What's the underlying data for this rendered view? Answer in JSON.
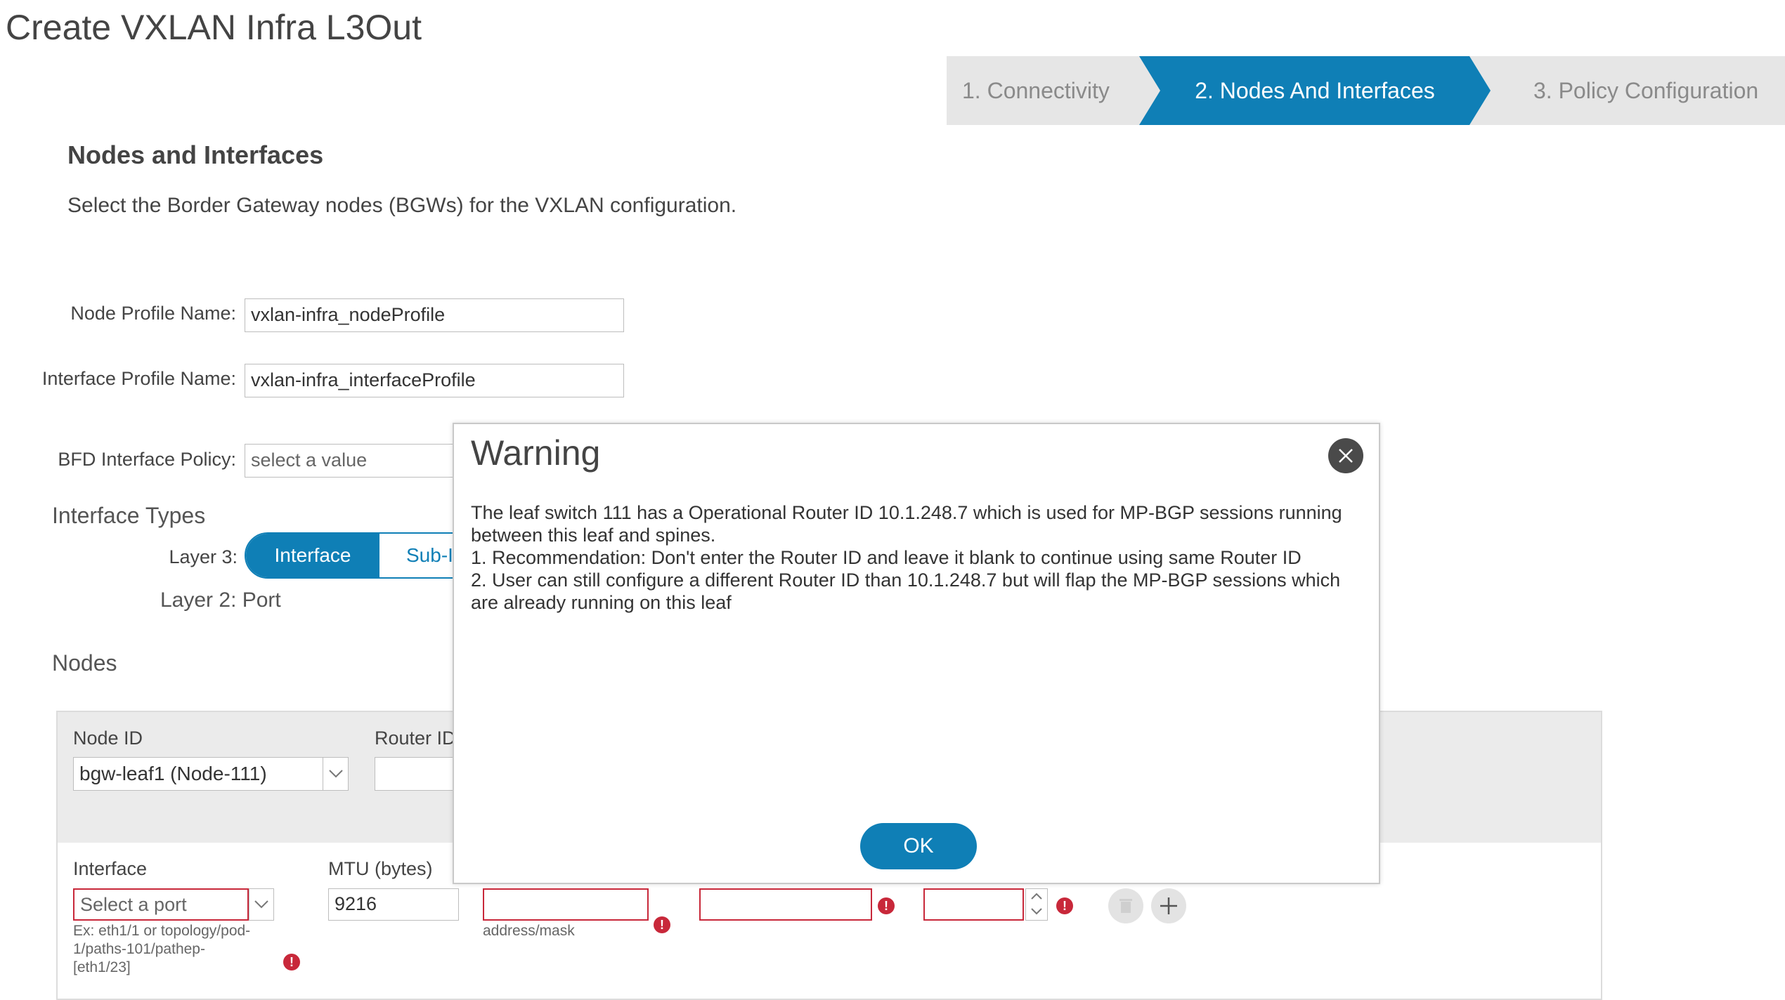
{
  "page": {
    "title": "Create VXLAN Infra L3Out"
  },
  "wizard": {
    "steps": [
      {
        "label": "1. Connectivity"
      },
      {
        "label": "2. Nodes And Interfaces"
      },
      {
        "label": "3. Policy Configuration"
      }
    ],
    "active_step": 2
  },
  "section": {
    "heading": "Nodes and Interfaces",
    "description": "Select the Border Gateway nodes (BGWs) for the VXLAN configuration."
  },
  "form": {
    "node_profile": {
      "label": "Node Profile Name:",
      "value": "vxlan-infra_nodeProfile"
    },
    "interface_profile": {
      "label": "Interface Profile Name:",
      "value": "vxlan-infra_interfaceProfile"
    },
    "bfd_policy": {
      "label": "BFD Interface Policy:",
      "placeholder": "select a value"
    }
  },
  "interface_types": {
    "heading": "Interface Types",
    "layer3_label": "Layer 3:",
    "options": [
      "Interface",
      "Sub-I"
    ],
    "selected": "Interface",
    "layer2_label": "Layer 2: Port"
  },
  "nodes": {
    "heading": "Nodes",
    "node_id_label": "Node ID",
    "node_id_value": "bgw-leaf1 (Node-111)",
    "router_id_label": "Router ID",
    "interface_label": "Interface",
    "interface_placeholder": "Select a port",
    "interface_hint": [
      "Ex: eth1/1 or topology/pod-",
      "1/paths-101/pathep-",
      "[eth1/23]"
    ],
    "mtu_label": "MTU (bytes)",
    "mtu_value": "9216",
    "address_hint": "address/mask"
  },
  "modal": {
    "title": "Warning",
    "lines": [
      "The leaf switch 111 has a Operational Router ID 10.1.248.7 which is used for MP-BGP sessions running",
      "between this leaf and spines.",
      "1. Recommendation: Don't enter the Router ID and leave it blank to continue using same Router ID",
      "2. User can still configure a different Router ID than 10.1.248.7 but will flap the MP-BGP sessions which",
      "are already running on this leaf"
    ],
    "ok_label": "OK"
  },
  "colors": {
    "accent": "#0f7fb6",
    "error": "#c8283a"
  },
  "icons": [
    "close-icon",
    "chevron-down-icon",
    "error-icon",
    "stepper-up-icon",
    "stepper-down-icon",
    "delete-icon",
    "add-icon"
  ]
}
